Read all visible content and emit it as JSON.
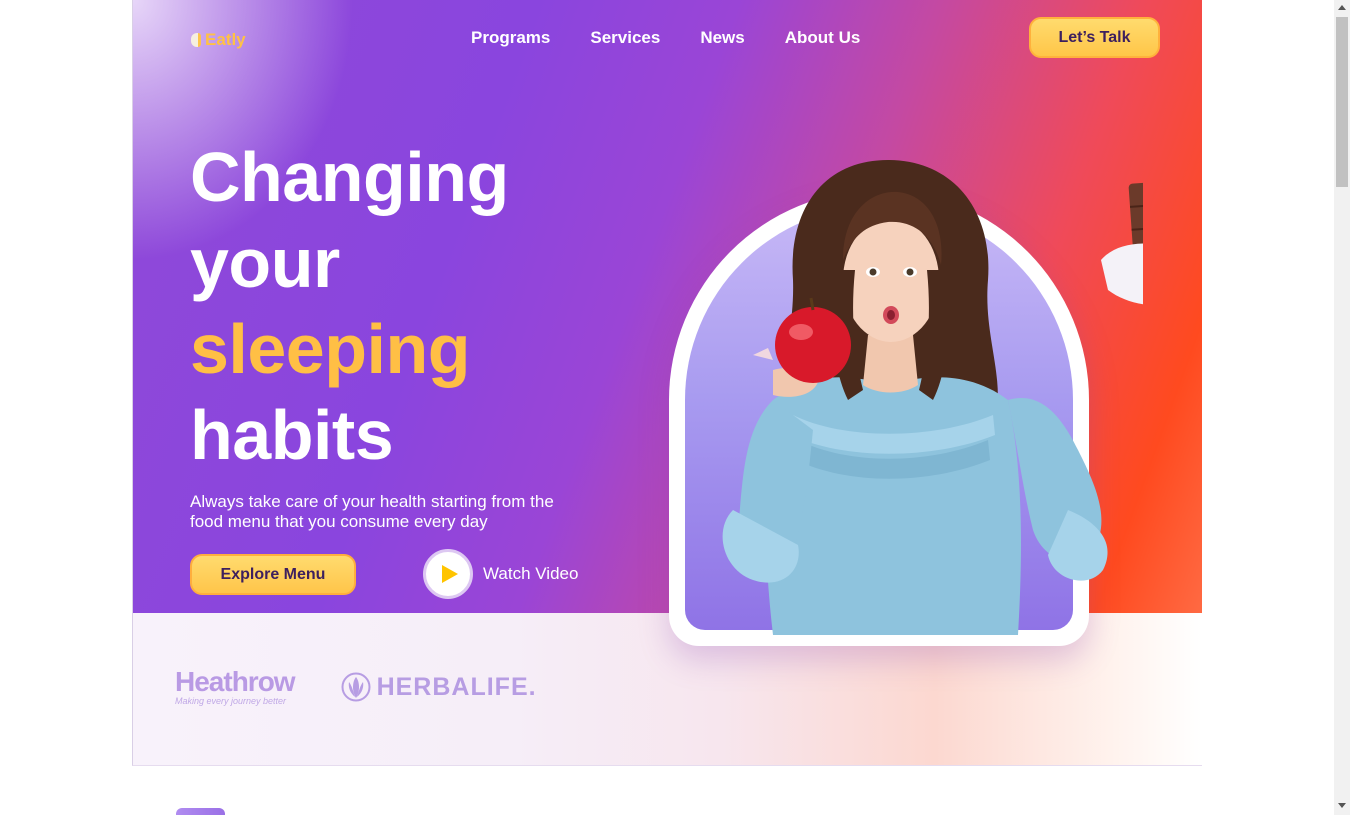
{
  "brand": {
    "name": "Eatly",
    "accent": "#ffc145"
  },
  "nav": {
    "items": [
      {
        "label": "Programs"
      },
      {
        "label": "Services"
      },
      {
        "label": "News"
      },
      {
        "label": "About Us"
      }
    ],
    "cta_label": "Let’s Talk"
  },
  "hero": {
    "headline": [
      "Changing",
      "your",
      "sleeping",
      "habits"
    ],
    "highlight_word": "sleeping",
    "subtext": "Always take care of your health starting from the food menu that you consume every day",
    "primary_button": "Explore Menu",
    "video_label": "Watch Video",
    "image_icon": "woman-holding-apple-and-chocolate"
  },
  "partners": {
    "heathrow": {
      "name": "Heathrow",
      "tagline": "Making every journey better"
    },
    "herbalife": {
      "name": "HERBALIFE."
    }
  },
  "colors": {
    "primary": "#8a45de",
    "secondary": "#ff4a1f",
    "button": "#ffc648",
    "button_text": "#3d1f5e"
  }
}
